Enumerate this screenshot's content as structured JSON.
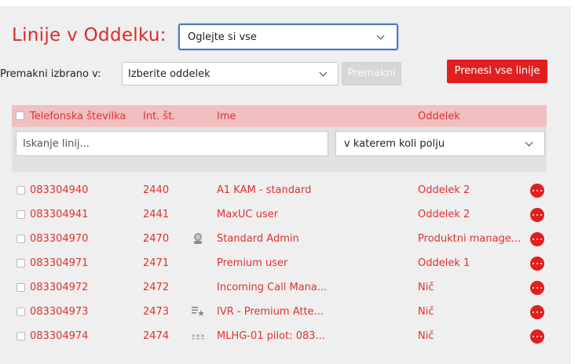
{
  "title": "Linije v Oddelku:",
  "view_select": {
    "value": "Oglejte si vse"
  },
  "move": {
    "label": "Premakni izbrano v:",
    "select_value": "Izberite oddelek",
    "button_label": "Premakni"
  },
  "transfer_all_label": "Prenesi vse linije",
  "table": {
    "headers": [
      "Telefonska številka",
      "Int. št.",
      "Ime",
      "Oddelek"
    ],
    "search_placeholder": "Iskanje linij...",
    "field_select_value": "v katerem koli polju",
    "rows": [
      {
        "phone": "083304940",
        "ext": "2440",
        "name": "A1 KAM - standard",
        "dept": "Oddelek 2",
        "icon": ""
      },
      {
        "phone": "083304941",
        "ext": "2441",
        "name": "MaxUC user",
        "dept": "Oddelek 2",
        "icon": ""
      },
      {
        "phone": "083304970",
        "ext": "2470",
        "name": "Standard Admin",
        "dept": "Produktni manage...",
        "icon": "user-admin-icon"
      },
      {
        "phone": "083304971",
        "ext": "2471",
        "name": "Premium user",
        "dept": "Oddelek 1",
        "icon": ""
      },
      {
        "phone": "083304972",
        "ext": "2472",
        "name": "Incoming Call Mana...",
        "dept": "Nič",
        "icon": ""
      },
      {
        "phone": "083304973",
        "ext": "2473",
        "name": "IVR - Premium Atte...",
        "dept": "Nič",
        "icon": "ivr-star-icon"
      },
      {
        "phone": "083304974",
        "ext": "2474",
        "name": "MLHG-01 pilot: 083...",
        "dept": "Nič",
        "icon": "hunt-group-icon"
      }
    ]
  },
  "colors": {
    "accent": "#e02020",
    "header_bg": "#f0c0c0",
    "focus_border": "#4a7ab8"
  }
}
